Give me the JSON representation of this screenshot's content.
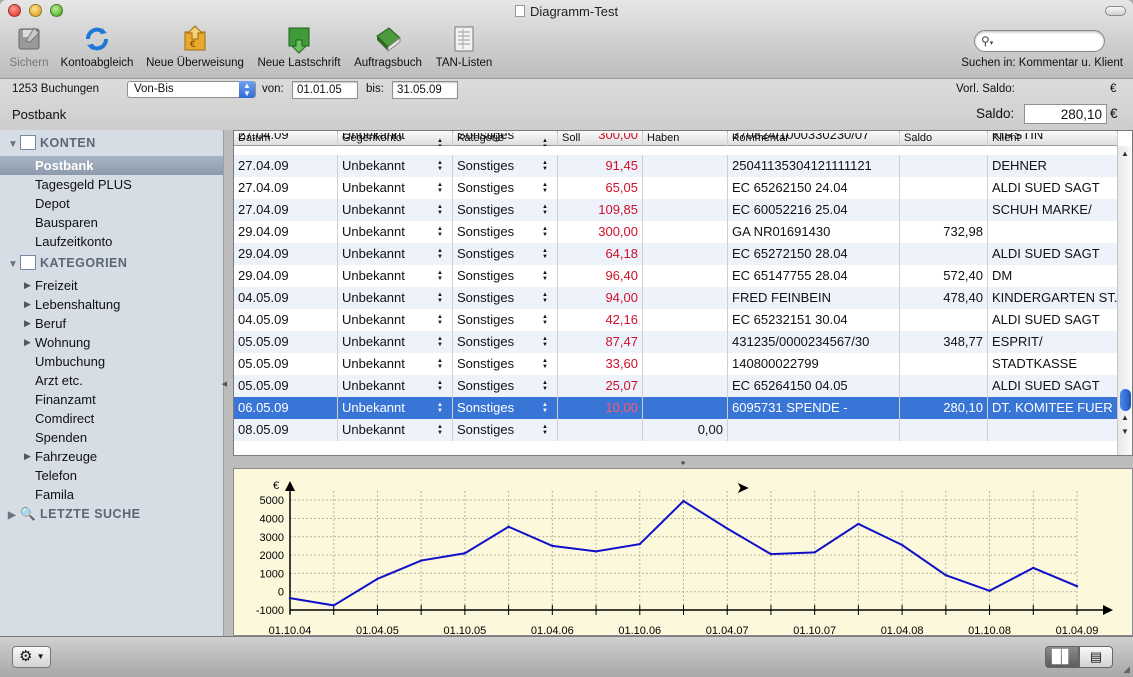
{
  "window": {
    "title": "Diagramm-Test"
  },
  "toolbar": {
    "items": [
      {
        "label": "Sichern",
        "icon": "save-icon"
      },
      {
        "label": "Kontoabgleich",
        "icon": "sync-icon"
      },
      {
        "label": "Neue Überweisung",
        "icon": "transfer-icon"
      },
      {
        "label": "Neue Lastschrift",
        "icon": "debit-icon"
      },
      {
        "label": "Auftragsbuch",
        "icon": "orderbook-icon"
      },
      {
        "label": "TAN-Listen",
        "icon": "tan-list-icon"
      }
    ],
    "search_placeholder": "",
    "search_in": "Suchen in: Kommentar u. Klient"
  },
  "infobar": {
    "count": "1253 Buchungen",
    "range_select": "Von-Bis",
    "from_label": "von:",
    "from_value": "01.01.05",
    "to_label": "bis:",
    "to_value": "31.05.09",
    "prev_saldo_label": "Vorl. Saldo:",
    "currency": "€",
    "account": "Postbank",
    "saldo_label": "Saldo:",
    "saldo_value": "280,10"
  },
  "sidebar": {
    "konten_header": "KONTEN",
    "konten": [
      "Postbank",
      "Tagesgeld PLUS",
      "Depot",
      "Bausparen",
      "Laufzeitkonto"
    ],
    "kategorien_header": "KATEGORIEN",
    "kategorien": [
      {
        "label": "Freizeit",
        "expandable": true
      },
      {
        "label": "Lebenshaltung",
        "expandable": true
      },
      {
        "label": "Beruf",
        "expandable": true
      },
      {
        "label": "Wohnung",
        "expandable": true
      },
      {
        "label": "Umbuchung",
        "expandable": false
      },
      {
        "label": "Arzt etc.",
        "expandable": false
      },
      {
        "label": "Finanzamt",
        "expandable": false
      },
      {
        "label": "Comdirect",
        "expandable": false
      },
      {
        "label": "Spenden",
        "expandable": false
      },
      {
        "label": "Fahrzeuge",
        "expandable": true
      },
      {
        "label": "Telefon",
        "expandable": false
      },
      {
        "label": "Famila",
        "expandable": false
      }
    ],
    "search_header": "LETZTE SUCHE"
  },
  "table": {
    "columns": [
      "Datum",
      "Gegenkonto",
      "Kategorie",
      "Soll",
      "Haben",
      "Kommentar",
      "Saldo",
      "Klient"
    ],
    "partial_row": [
      "27.04.09",
      "Unbekannt",
      "Sonstiges",
      "300,00",
      "",
      "370824/1000330230/07",
      "",
      "KIRSTIN"
    ],
    "rows": [
      [
        "27.04.09",
        "Unbekannt",
        "Sonstiges",
        "91,45",
        "",
        "25041135304121111121",
        "",
        "DEHNER"
      ],
      [
        "27.04.09",
        "Unbekannt",
        "Sonstiges",
        "65,05",
        "",
        "EC 65262150 24.04",
        "",
        "ALDI SUED SAGT"
      ],
      [
        "27.04.09",
        "Unbekannt",
        "Sonstiges",
        "109,85",
        "",
        "EC 60052216 25.04",
        "",
        "SCHUH MARKE/"
      ],
      [
        "29.04.09",
        "Unbekannt",
        "Sonstiges",
        "300,00",
        "",
        "GA NR01691430",
        "732,98",
        ""
      ],
      [
        "29.04.09",
        "Unbekannt",
        "Sonstiges",
        "64,18",
        "",
        "EC 65272150 28.04",
        "",
        "ALDI SUED SAGT"
      ],
      [
        "29.04.09",
        "Unbekannt",
        "Sonstiges",
        "96,40",
        "",
        "EC 65147755 28.04",
        "572,40",
        "DM"
      ],
      [
        "04.05.09",
        "Unbekannt",
        "Sonstiges",
        "94,00",
        "",
        "FRED FEINBEIN",
        "478,40",
        "KINDERGARTEN ST."
      ],
      [
        "04.05.09",
        "Unbekannt",
        "Sonstiges",
        "42,16",
        "",
        "EC 65232151 30.04",
        "",
        "ALDI SUED SAGT"
      ],
      [
        "05.05.09",
        "Unbekannt",
        "Sonstiges",
        "87,47",
        "",
        "431235/0000234567/30",
        "348,77",
        "ESPRIT/"
      ],
      [
        "05.05.09",
        "Unbekannt",
        "Sonstiges",
        "33,60",
        "",
        "140800022799",
        "",
        "STADTKASSE"
      ],
      [
        "05.05.09",
        "Unbekannt",
        "Sonstiges",
        "25,07",
        "",
        "EC 65264150 04.05",
        "",
        "ALDI SUED SAGT"
      ],
      [
        "06.05.09",
        "Unbekannt",
        "Sonstiges",
        "10,00",
        "",
        "6095731 SPENDE -",
        "280,10",
        "DT. KOMITEE FUER"
      ],
      [
        "08.05.09",
        "Unbekannt",
        "Sonstiges",
        "",
        "0,00",
        "",
        "",
        ""
      ]
    ],
    "selected_index": 11
  },
  "chart_data": {
    "type": "line",
    "ylabel": "€",
    "xlabel": "",
    "x": [
      "01.10.04",
      "01.01.05",
      "01.04.05",
      "01.07.05",
      "01.10.05",
      "01.01.06",
      "01.04.06",
      "01.07.06",
      "01.10.06",
      "01.01.07",
      "01.04.07",
      "01.07.07",
      "01.10.07",
      "01.01.08",
      "01.04.08",
      "01.07.08",
      "01.10.08",
      "01.01.09",
      "01.04.09"
    ],
    "x_tick_labels": [
      "01.10.04",
      "01.04.05",
      "01.10.05",
      "01.04.06",
      "01.10.06",
      "01.04.07",
      "01.10.07",
      "01.04.08",
      "01.10.08",
      "01.04.09"
    ],
    "series": [
      {
        "values": [
          -350,
          -750,
          700,
          1700,
          2100,
          3550,
          2500,
          2200,
          2600,
          4950,
          3450,
          2050,
          2150,
          3700,
          2550,
          900,
          50,
          1300,
          300
        ],
        "color": "#1010c8"
      }
    ],
    "yticks": [
      -1000,
      0,
      1000,
      2000,
      3000,
      4000,
      5000
    ],
    "ylim": [
      -1000,
      5500
    ],
    "grid": true
  }
}
